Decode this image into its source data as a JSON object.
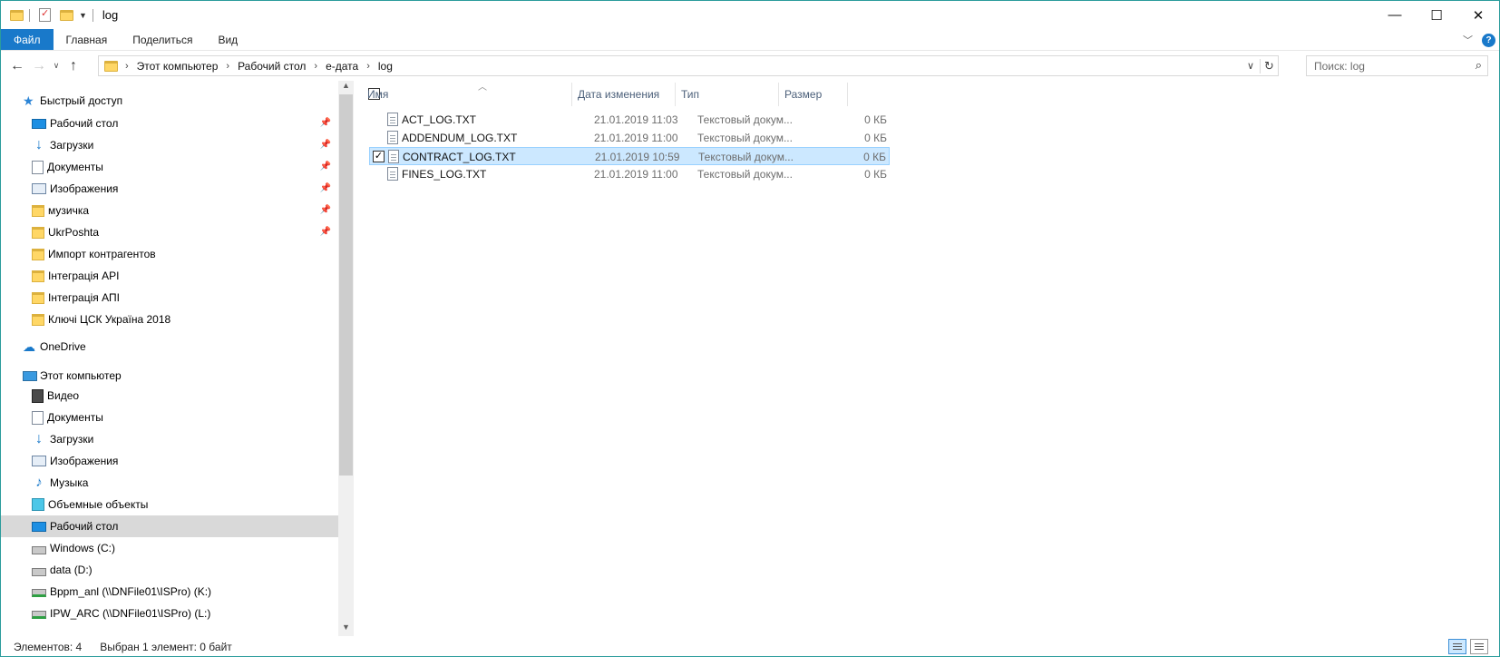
{
  "window": {
    "title": "log",
    "controls": {
      "minimize": "—",
      "maximize": "☐",
      "close": "✕"
    }
  },
  "ribbon": {
    "tabs": [
      "Файл",
      "Главная",
      "Поделиться",
      "Вид"
    ],
    "help": "?"
  },
  "address": {
    "crumbs": [
      "Этот компьютер",
      "Рабочий стол",
      "e-дата",
      "log"
    ],
    "search_placeholder": "Поиск: log"
  },
  "nav": {
    "quick_access": "Быстрый доступ",
    "quick_items": [
      {
        "label": "Рабочий стол",
        "icon": "desktop-icon",
        "pinned": true
      },
      {
        "label": "Загрузки",
        "icon": "download-icon",
        "pinned": true
      },
      {
        "label": "Документы",
        "icon": "document-icon",
        "pinned": true
      },
      {
        "label": "Изображения",
        "icon": "picture-icon",
        "pinned": true
      },
      {
        "label": "музичка",
        "icon": "folder-icon",
        "pinned": true
      },
      {
        "label": "UkrPoshta",
        "icon": "folder-icon",
        "pinned": true
      },
      {
        "label": "Импорт контрагентов",
        "icon": "folder-icon",
        "pinned": false
      },
      {
        "label": "Інтеграція API",
        "icon": "folder-icon",
        "pinned": false
      },
      {
        "label": "Інтеграція АПІ",
        "icon": "folder-icon",
        "pinned": false
      },
      {
        "label": "Ключі ЦСК Україна 2018",
        "icon": "folder-icon",
        "pinned": false
      }
    ],
    "onedrive": "OneDrive",
    "this_pc": "Этот компьютер",
    "pc_items": [
      {
        "label": "Видео",
        "icon": "video-icon"
      },
      {
        "label": "Документы",
        "icon": "document-icon"
      },
      {
        "label": "Загрузки",
        "icon": "download-icon"
      },
      {
        "label": "Изображения",
        "icon": "picture-icon"
      },
      {
        "label": "Музыка",
        "icon": "music-icon"
      },
      {
        "label": "Объемные объекты",
        "icon": "3d-objects-icon"
      },
      {
        "label": "Рабочий стол",
        "icon": "desktop-icon",
        "selected": true
      },
      {
        "label": "Windows (C:)",
        "icon": "drive-icon"
      },
      {
        "label": "data (D:)",
        "icon": "drive-icon"
      },
      {
        "label": "Bppm_anl (\\\\DNFile01\\ISPro) (K:)",
        "icon": "network-drive-icon"
      },
      {
        "label": "IPW_ARC (\\\\DNFile01\\ISPro) (L:)",
        "icon": "network-drive-icon"
      }
    ]
  },
  "files": {
    "columns": [
      "Имя",
      "Дата изменения",
      "Тип",
      "Размер"
    ],
    "rows": [
      {
        "name": "ACT_LOG.TXT",
        "date": "21.01.2019 11:03",
        "type": "Текстовый докум...",
        "size": "0 КБ",
        "selected": false
      },
      {
        "name": "ADDENDUM_LOG.TXT",
        "date": "21.01.2019 11:00",
        "type": "Текстовый докум...",
        "size": "0 КБ",
        "selected": false
      },
      {
        "name": "CONTRACT_LOG.TXT",
        "date": "21.01.2019 10:59",
        "type": "Текстовый докум...",
        "size": "0 КБ",
        "selected": true
      },
      {
        "name": "FINES_LOG.TXT",
        "date": "21.01.2019 11:00",
        "type": "Текстовый докум...",
        "size": "0 КБ",
        "selected": false
      }
    ]
  },
  "status": {
    "count": "Элементов: 4",
    "selection": "Выбран 1 элемент: 0 байт"
  },
  "colors": {
    "accent": "#1979ca",
    "selection_bg": "#cce8ff",
    "selection_border": "#99d1ff",
    "nav_selected": "#d9d9d9"
  }
}
